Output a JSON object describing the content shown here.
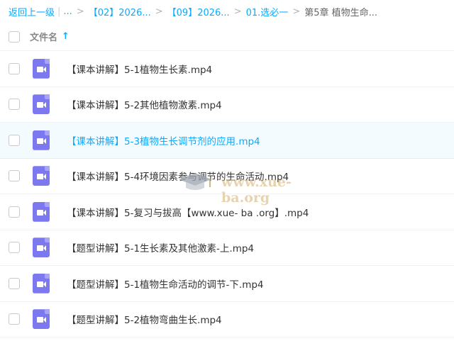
{
  "breadcrumb": {
    "back": "返回上一级",
    "pipe": "|",
    "ellipsis": "...",
    "sep": ">",
    "items": [
      "【02】2026...",
      "【09】2026...",
      "01.选必一"
    ],
    "current": "第5章 植物生命..."
  },
  "header": {
    "column_label": "文件名",
    "sort_icon": "↑"
  },
  "files": [
    {
      "name": "【课本讲解】5-1植物生长素.mp4",
      "icon": "video-file-icon"
    },
    {
      "name": "【课本讲解】5-2其他植物激素.mp4",
      "icon": "video-file-icon"
    },
    {
      "name": "【课本讲解】5-3植物生长调节剂的应用.mp4",
      "icon": "video-file-icon",
      "hovered": true
    },
    {
      "name": "【课本讲解】5-4环境因素参与调节的生命活动.mp4",
      "icon": "video-file-icon"
    },
    {
      "name": "【课本讲解】5-复习与拔高【www.xue- ba .org】.mp4",
      "icon": "video-file-icon"
    },
    {
      "name": "【题型讲解】5-1生长素及其他激素-上.mp4",
      "icon": "video-file-icon"
    },
    {
      "name": "【题型讲解】5-1植物生命活动的调节-下.mp4",
      "icon": "video-file-icon"
    },
    {
      "name": "【题型讲解】5-2植物弯曲生长.mp4",
      "icon": "video-file-icon"
    }
  ],
  "watermark": {
    "text": "www.xue-ba.org"
  },
  "colors": {
    "accent": "#09aaff",
    "file_icon": "#7b78f0",
    "hover_row": "#f4fbff"
  }
}
